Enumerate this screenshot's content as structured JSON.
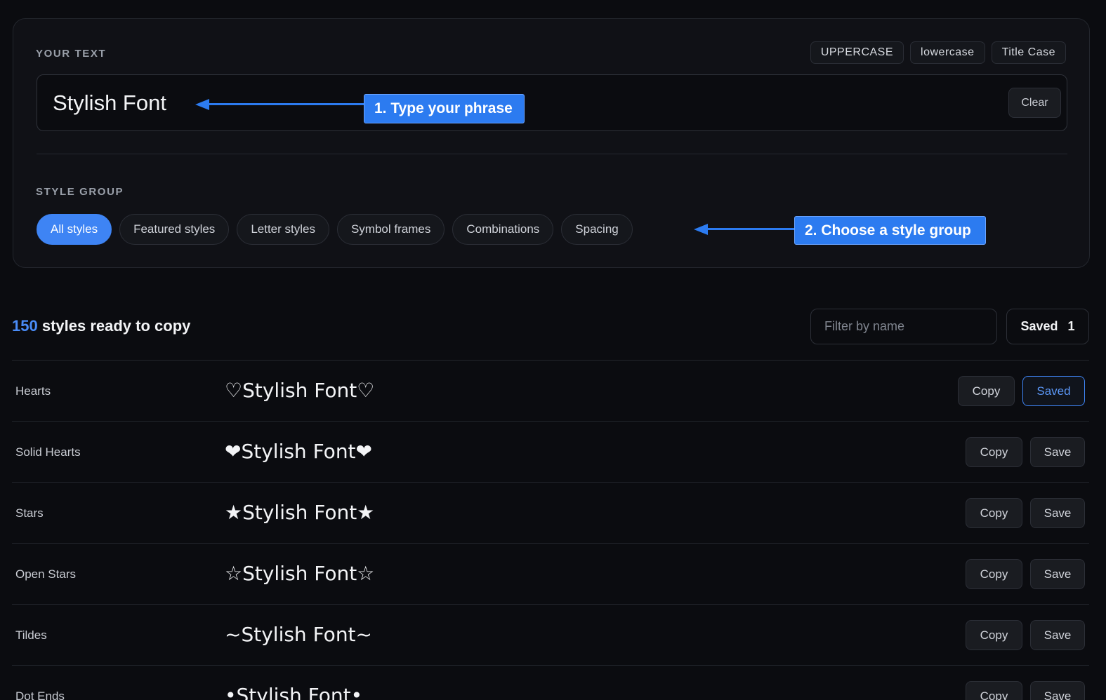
{
  "input_panel": {
    "your_text_label": "YOUR TEXT",
    "case_buttons": [
      "UPPERCASE",
      "lowercase",
      "Title Case"
    ],
    "text_value": "Stylish Font",
    "clear_label": "Clear",
    "style_group_label": "STYLE GROUP",
    "style_groups": [
      "All styles",
      "Featured styles",
      "Letter styles",
      "Symbol frames",
      "Combinations",
      "Spacing"
    ],
    "active_group": "All styles"
  },
  "callouts": {
    "step1": "1. Type your phrase",
    "step2": "2. Choose a style group"
  },
  "results": {
    "count": "150",
    "count_suffix": "styles ready to copy",
    "filter_placeholder": "Filter by name",
    "saved_label": "Saved",
    "saved_count": "1",
    "rows": [
      {
        "name": "Hearts",
        "preview": "♡Stylish Font♡",
        "copy": "Copy",
        "save": "Saved",
        "saved": true
      },
      {
        "name": "Solid Hearts",
        "preview": "❤Stylish Font❤",
        "copy": "Copy",
        "save": "Save",
        "saved": false
      },
      {
        "name": "Stars",
        "preview": "★Stylish Font★",
        "copy": "Copy",
        "save": "Save",
        "saved": false
      },
      {
        "name": "Open Stars",
        "preview": "☆Stylish Font☆",
        "copy": "Copy",
        "save": "Save",
        "saved": false
      },
      {
        "name": "Tildes",
        "preview": "~Stylish Font~",
        "copy": "Copy",
        "save": "Save",
        "saved": false
      },
      {
        "name": "Dot Ends",
        "preview": "•Stylish Font•",
        "copy": "Copy",
        "save": "Save",
        "saved": false
      }
    ]
  },
  "colors": {
    "accent": "#3e84f4",
    "callout": "#2c7bf0",
    "background": "#0b0c10"
  }
}
